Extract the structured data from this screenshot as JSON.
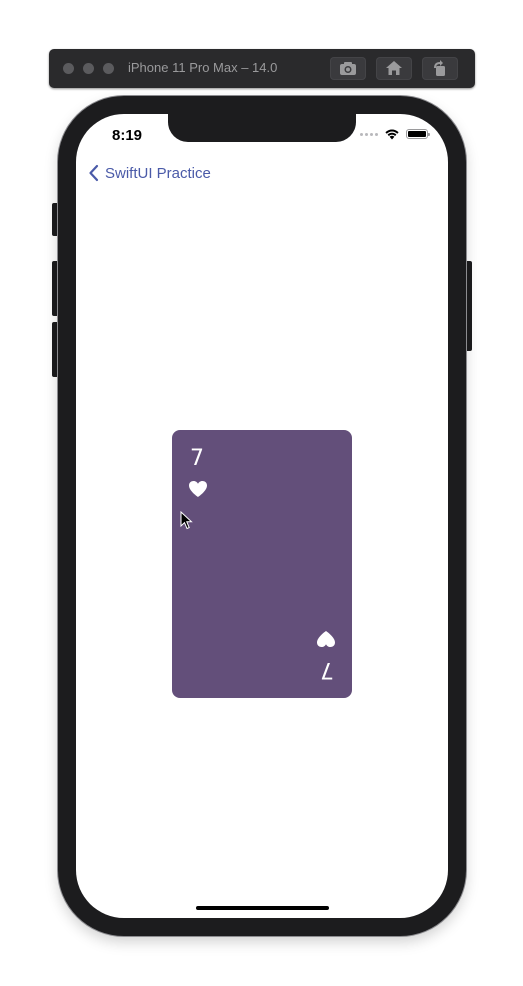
{
  "simulator": {
    "title": "iPhone 11 Pro Max – 14.0",
    "buttons": [
      {
        "name": "screenshot",
        "icon": "camera-icon"
      },
      {
        "name": "home",
        "icon": "home-icon"
      },
      {
        "name": "rotate",
        "icon": "rotate-icon"
      }
    ]
  },
  "status_bar": {
    "time": "8:19"
  },
  "nav": {
    "back_label": "SwiftUI Practice"
  },
  "card": {
    "rank": "7",
    "suit": "heart",
    "color": "#634f7a",
    "pip_color": "#ffffff"
  },
  "colors": {
    "accent": "#4a5aa8"
  }
}
